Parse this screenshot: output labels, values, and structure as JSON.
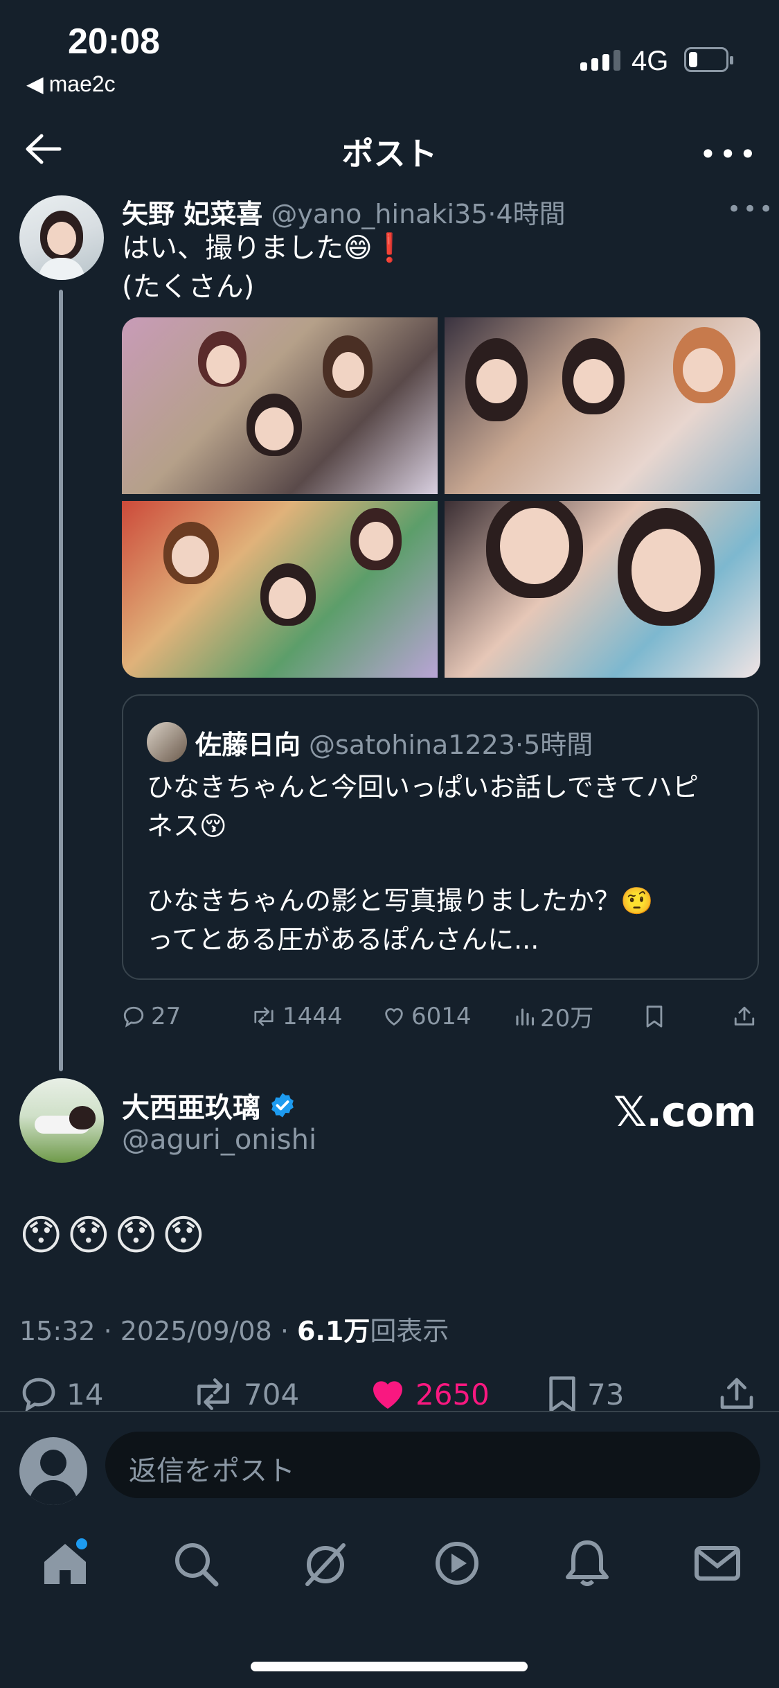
{
  "status_bar": {
    "time": "20:08",
    "back_app": "mae2c",
    "network": "4G",
    "battery_icon": "battery-icon",
    "signal_icon": "signal-icon"
  },
  "header": {
    "title": "ポスト",
    "back_icon": "back-arrow-icon",
    "more_icon": "more-icon"
  },
  "quoted_tweet": {
    "display_name": "矢野 妃菜喜",
    "handle": "@yano_hinaki35",
    "separator": "·",
    "time": "4時間",
    "text_line1": "はい、撮りました😄❗️",
    "text_line2": "(たくさん)",
    "photos": [
      "photo-1",
      "photo-2",
      "photo-3",
      "photo-4"
    ],
    "nested_quote": {
      "display_name": "佐藤日向",
      "handle": "@satohina1223",
      "separator": "·",
      "time": "5時間",
      "text_line1": "ひなきちゃんと今回いっぱいお話しできてハピ",
      "text_line2": "ネス😚",
      "text_line3": "ひなきちゃんの影と写真撮りましたか？🤨",
      "text_line4": "ってとある圧があるぽんさんに..."
    },
    "actions": {
      "replies": "27",
      "retweets": "1444",
      "likes": "6014",
      "views": "20万"
    }
  },
  "main_tweet": {
    "display_name": "大西亜玖璃",
    "verified": true,
    "handle": "@aguri_onishi",
    "brand": "𝕏.com",
    "text": "😯😯😯😯",
    "meta_time": "15:32 · 2025/09/08 · ",
    "meta_views_count": "6.1万",
    "meta_views_label": "回表示",
    "actions": {
      "replies": "14",
      "retweets": "704",
      "likes": "2650",
      "bookmarks": "73"
    }
  },
  "reply": {
    "placeholder": "返信をポスト"
  },
  "bottom_nav": [
    "home-icon",
    "search-icon",
    "grok-icon",
    "video-icon",
    "notifications-icon",
    "messages-icon"
  ],
  "colors": {
    "background": "#15202b",
    "like": "#f91880",
    "verified": "#1d9bf0",
    "muted": "#8b98a5"
  }
}
